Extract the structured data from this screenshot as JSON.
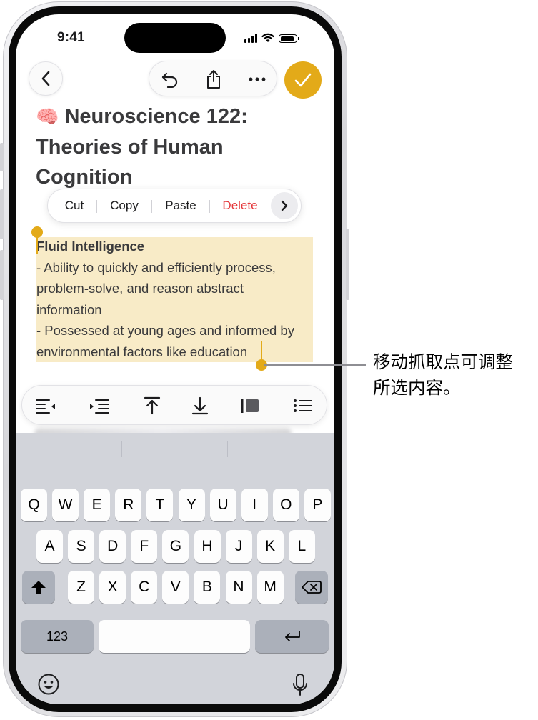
{
  "status_bar": {
    "time": "9:41",
    "battery_level": 0.9
  },
  "nav": {
    "back_icon": "chevron-left-icon",
    "undo_icon": "undo-arrow-icon",
    "share_icon": "share-icon",
    "more_icon": "ellipsis-icon",
    "done_icon": "checkmark-icon"
  },
  "note": {
    "title_emoji": "🧠",
    "title_lines": [
      "Neuroscience 122:",
      "Theories of Human",
      "Cognition"
    ]
  },
  "edit_menu": {
    "cut": "Cut",
    "copy": "Copy",
    "paste": "Paste",
    "delete": "Delete",
    "more_icon": "chevron-right-icon"
  },
  "selection": {
    "heading": "Fluid Intelligence",
    "lines": [
      "- Ability to quickly and efficiently process,",
      "problem-solve, and reason abstract",
      "information",
      "- Possessed at young ages and informed by",
      "environmental factors like education"
    ]
  },
  "format_bar": {
    "icons": [
      "outdent-icon",
      "indent-icon",
      "move-up-icon",
      "move-down-icon",
      "block-quote-icon",
      "bullet-list-icon"
    ]
  },
  "keyboard": {
    "row1": [
      "Q",
      "W",
      "E",
      "R",
      "T",
      "Y",
      "U",
      "I",
      "O",
      "P"
    ],
    "row2": [
      "A",
      "S",
      "D",
      "F",
      "G",
      "H",
      "J",
      "K",
      "L"
    ],
    "row3": [
      "Z",
      "X",
      "C",
      "V",
      "B",
      "N",
      "M"
    ],
    "numbers_key": "123",
    "shift_icon": "shift-icon",
    "delete_icon": "backspace-icon",
    "return_icon": "return-icon",
    "emoji_icon": "emoji-icon",
    "mic_icon": "microphone-icon"
  },
  "callout": {
    "lines": [
      "移动抓取点可调整",
      "所选内容。"
    ]
  },
  "colors": {
    "accent": "#e3aa19",
    "selection": "#f8ebc7",
    "delete": "#e5383b"
  }
}
